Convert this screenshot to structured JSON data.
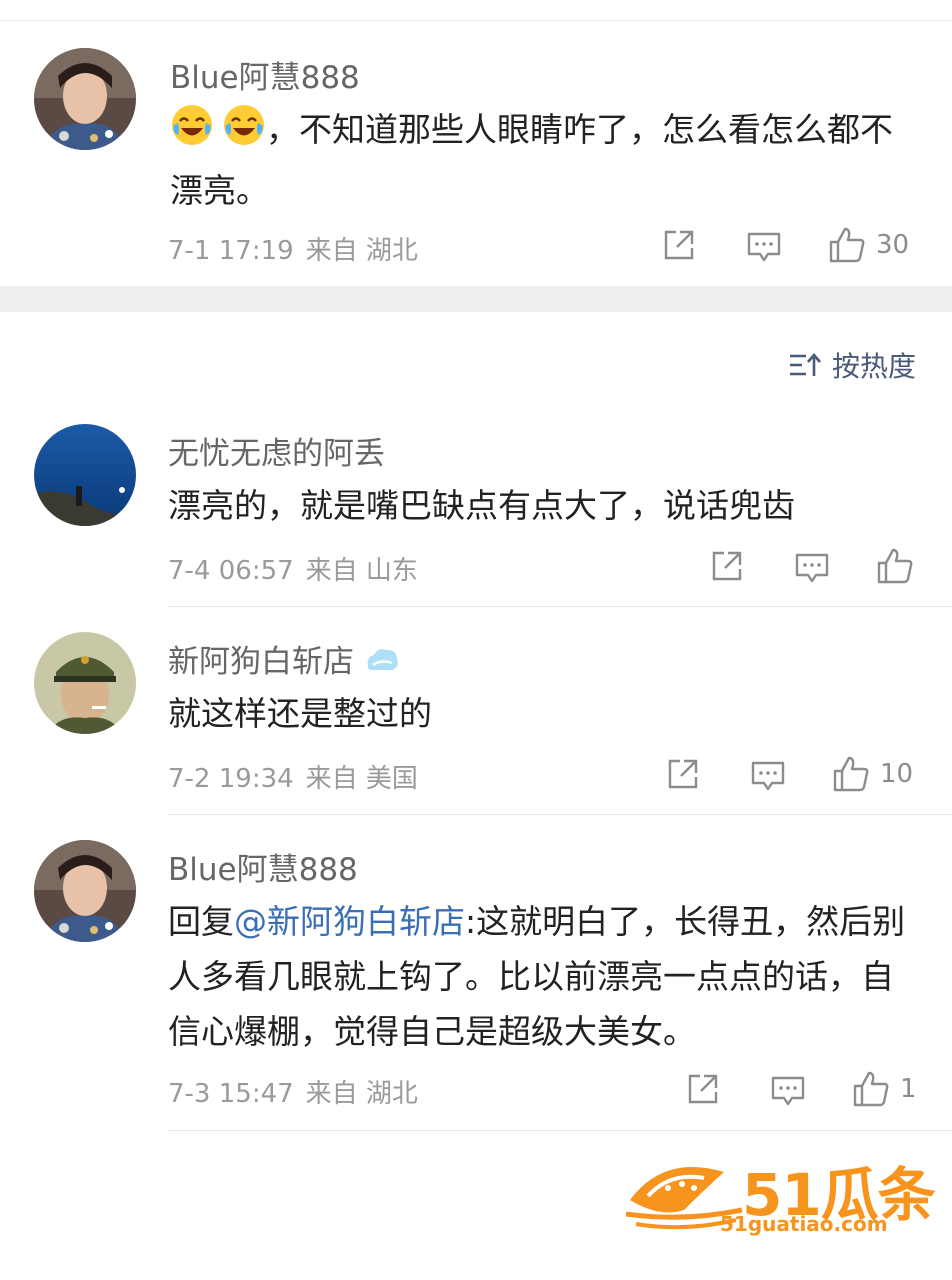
{
  "sort": {
    "label": "按热度"
  },
  "comments": [
    {
      "author": "Blue阿慧888",
      "text_after_emoji": "，不知道那些人眼睛咋了，怎么看怎么都不漂亮。",
      "date": "7-1 17:19",
      "from": "来自 湖北",
      "likes": "30"
    },
    {
      "author": "无忧无虑的阿丢",
      "text": "漂亮的，就是嘴巴缺点有点大了，说话兜齿",
      "date": "7-4 06:57",
      "from": "来自 山东",
      "likes": ""
    },
    {
      "author": "新阿狗白斩店",
      "text": "就这样还是整过的",
      "date": "7-2 19:34",
      "from": "来自 美国",
      "likes": "10"
    },
    {
      "author": "Blue阿慧888",
      "reply_prefix": "回复",
      "mention": "@新阿狗白斩店",
      "text": ":这就明白了，长得丑，然后别人多看几眼就上钩了。比以前漂亮一点点的话，自信心爆棚，觉得自己是超级大美女。",
      "date": "7-3 15:47",
      "from": "来自 湖北",
      "likes": "1"
    }
  ],
  "watermark": {
    "brand": "51瓜条",
    "url": "51guatiao.com"
  },
  "colors": {
    "accent": "#f7941d",
    "link": "#3a6fb5",
    "divider": "#eeeeee"
  }
}
